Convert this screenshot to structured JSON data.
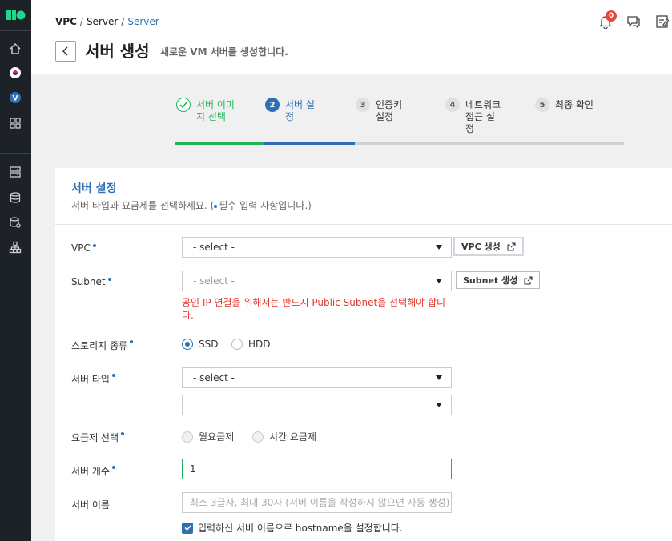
{
  "breadcrumb": {
    "item1": "VPC",
    "item2": "Server",
    "item3": "Server"
  },
  "header": {
    "title": "서버 생성",
    "subtitle": "새로운 VM 서버를 생성합니다.",
    "notification_count": "0"
  },
  "steps": [
    {
      "number": "",
      "label": "서버 이미지 선택",
      "state": "done"
    },
    {
      "number": "2",
      "label": "서버 설정",
      "state": "active"
    },
    {
      "number": "3",
      "label": "인증키 설정",
      "state": "todo"
    },
    {
      "number": "4",
      "label": "네트워크 접근 설정",
      "state": "todo"
    },
    {
      "number": "5",
      "label": "최종 확인",
      "state": "todo"
    }
  ],
  "section": {
    "title": "서버 설정",
    "desc_before": "서버 타입과 요금제를 선택하세요. (",
    "desc_after": "필수 입력 사항입니다.)"
  },
  "form": {
    "vpc": {
      "label": "VPC",
      "value": "- select -",
      "button": "VPC 생성"
    },
    "subnet": {
      "label": "Subnet",
      "value": "- select -",
      "button": "Subnet 생성",
      "warning": "공인 IP 연결을 위해서는 반드시 Public Subnet을 선택해야 합니다."
    },
    "storage": {
      "label": "스토리지 종류",
      "option1": "SSD",
      "option2": "HDD"
    },
    "server_type": {
      "label": "서버 타입",
      "value": "- select -",
      "value2": ""
    },
    "billing": {
      "label": "요금제 선택",
      "option1": "월요금제",
      "option2": "시간 요금제"
    },
    "count": {
      "label": "서버 개수",
      "value": "1"
    },
    "name": {
      "label": "서버 이름",
      "placeholder": "최소 3글자, 최대 30자 (서버 이름을 작성하지 않으면 자동 생성)"
    },
    "hostname_checkbox": "입력하신 서버 이름으로 hostname을 설정합니다."
  },
  "colors": {
    "accent": "#2f6fb3",
    "success": "#1fb35b",
    "error": "#e0392f",
    "sidebar": "#1d2128"
  }
}
